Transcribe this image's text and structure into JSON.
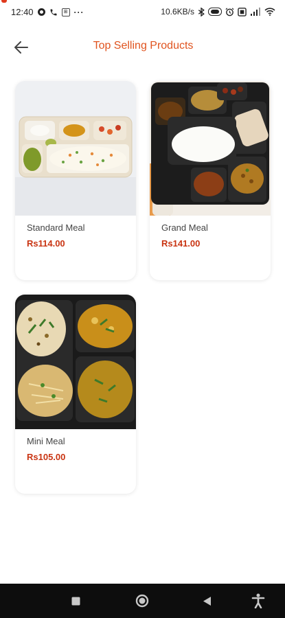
{
  "status_bar": {
    "time": "12:40",
    "network_speed": "10.6KB/s",
    "icons_left": [
      "notification-dot-icon",
      "phone-icon",
      "app-box-icon",
      "more-dots-icon"
    ],
    "icons_right": [
      "bluetooth-icon",
      "hd-icon",
      "alarm-icon",
      "battery-saver-icon",
      "signal-icon",
      "wifi-icon"
    ],
    "more_label": "···"
  },
  "header": {
    "title": "Top Selling Products",
    "back_icon": "arrow-left-icon"
  },
  "products": [
    {
      "name": "Standard Meal",
      "price": "Rs114.00"
    },
    {
      "name": "Grand Meal",
      "price": "Rs141.00"
    },
    {
      "name": "Mini Meal",
      "price": "Rs105.00"
    }
  ],
  "colors": {
    "accent": "#e0531e",
    "price": "#c93412",
    "nav_bar": "#0d0d0d"
  },
  "nav_bar": {
    "buttons": [
      "recents-square-icon",
      "home-circle-icon",
      "back-triangle-icon",
      "accessibility-icon"
    ]
  }
}
